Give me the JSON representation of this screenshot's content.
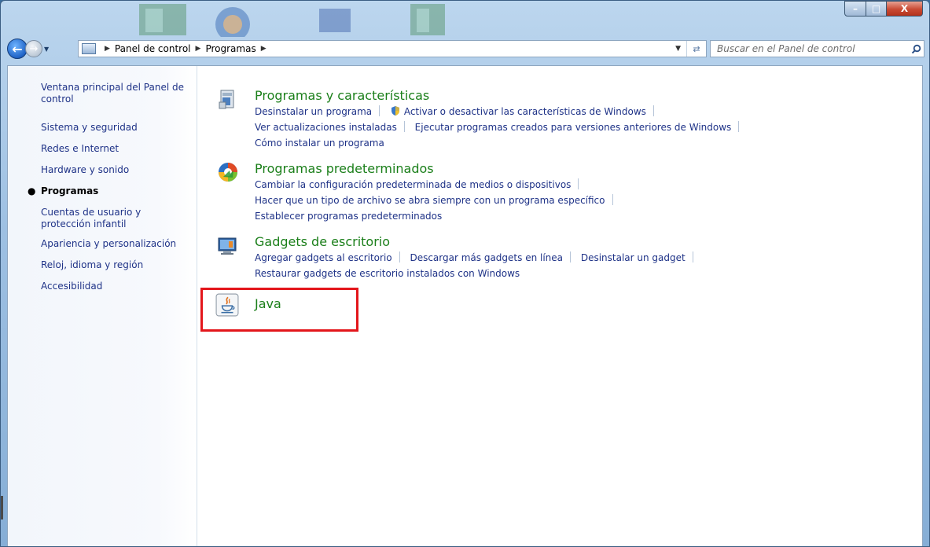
{
  "window": {
    "minimize_glyph": "–",
    "maximize_glyph": "□",
    "close_glyph": "X"
  },
  "nav": {
    "breadcrumb": [
      "Panel de control",
      "Programas"
    ],
    "search_placeholder": "Buscar en el Panel de control"
  },
  "sidebar": {
    "items": [
      {
        "label": "Ventana principal del Panel de control",
        "current": false
      },
      {
        "label": "Sistema y seguridad",
        "current": false
      },
      {
        "label": "Redes e Internet",
        "current": false
      },
      {
        "label": "Hardware y sonido",
        "current": false
      },
      {
        "label": "Programas",
        "current": true
      },
      {
        "label": "Cuentas de usuario y protección infantil",
        "current": false
      },
      {
        "label": "Apariencia y personalización",
        "current": false
      },
      {
        "label": "Reloj, idioma y región",
        "current": false
      },
      {
        "label": "Accesibilidad",
        "current": false
      }
    ]
  },
  "categories": [
    {
      "title": "Programas y características",
      "icon": "programs-features-icon",
      "links": [
        [
          "Desinstalar un programa",
          "Activar o desactivar las características de Windows"
        ],
        [
          "Ver actualizaciones instaladas",
          "Ejecutar programas creados para versiones anteriores de Windows"
        ],
        [
          "Cómo instalar un programa"
        ]
      ]
    },
    {
      "title": "Programas predeterminados",
      "icon": "default-programs-icon",
      "links": [
        [
          "Cambiar la configuración predeterminada de medios o dispositivos"
        ],
        [
          "Hacer que un tipo de archivo se abra siempre con un programa específico"
        ],
        [
          "Establecer programas predeterminados"
        ]
      ]
    },
    {
      "title": "Gadgets de escritorio",
      "icon": "desktop-gadgets-icon",
      "links": [
        [
          "Agregar gadgets al escritorio",
          "Descargar más gadgets en línea",
          "Desinstalar un gadget"
        ],
        [
          "Restaurar gadgets de escritorio instalados con Windows"
        ]
      ]
    },
    {
      "title": "Java",
      "icon": "java-icon",
      "links": []
    }
  ],
  "colors": {
    "category_title": "#1b7f1a",
    "link": "#1e3287",
    "highlight_box": "#e3161b"
  }
}
